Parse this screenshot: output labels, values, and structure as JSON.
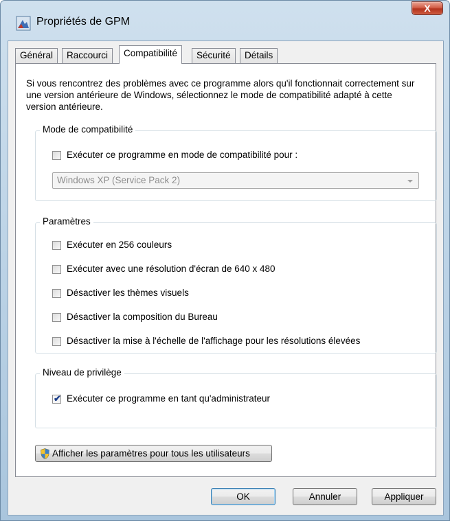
{
  "window": {
    "title": "Propriétés de GPM",
    "close_label": "X"
  },
  "tabs": [
    {
      "label": "Général"
    },
    {
      "label": "Raccourci"
    },
    {
      "label": "Compatibilité",
      "active": true
    },
    {
      "label": "Sécurité"
    },
    {
      "label": "Détails"
    }
  ],
  "intro_text": "Si vous rencontrez des problèmes avec ce programme alors qu'il fonctionnait correctement sur une version antérieure de Windows, sélectionnez le mode de compatibilité adapté à cette version antérieure.",
  "compat_mode": {
    "legend": "Mode de compatibilité",
    "checkbox_label": "Exécuter ce programme en mode de compatibilité pour :",
    "checked": false,
    "select_value": "Windows XP (Service Pack 2)"
  },
  "settings": {
    "legend": "Paramètres",
    "options": [
      {
        "label": "Exécuter en 256 couleurs",
        "checked": false
      },
      {
        "label": "Exécuter avec une résolution d'écran de 640 x 480",
        "checked": false
      },
      {
        "label": "Désactiver les thèmes visuels",
        "checked": false
      },
      {
        "label": "Désactiver la composition du Bureau",
        "checked": false
      },
      {
        "label": "Désactiver la mise à l'échelle de l'affichage pour les résolutions élevées",
        "checked": false
      }
    ]
  },
  "privilege": {
    "legend": "Niveau de privilège",
    "checkbox_label": "Exécuter ce programme en tant qu'administrateur",
    "checked": true
  },
  "all_users_button": {
    "label": "Afficher les paramètres pour tous les utilisateurs",
    "icon": "uac-shield-icon"
  },
  "buttons": {
    "ok": "OK",
    "cancel": "Annuler",
    "apply": "Appliquer"
  }
}
